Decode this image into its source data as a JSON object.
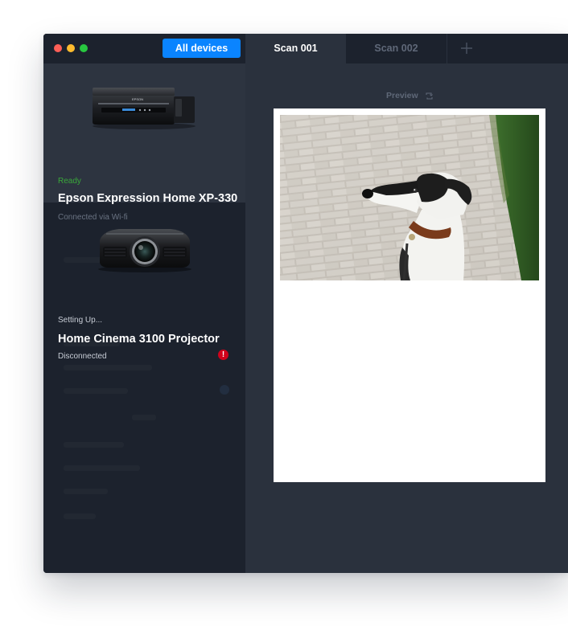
{
  "toolbar": {
    "all_devices_label": "All devices"
  },
  "devices": [
    {
      "status": "Ready",
      "status_color": "#3aa83a",
      "name": "Epson Expression Home XP-330",
      "connection": "Connected via Wi-fi",
      "icon": "printer-icon",
      "selected": true
    },
    {
      "status": "Setting Up...",
      "status_color": "#c8cdd6",
      "name": "Home Cinema 3100 Projector",
      "connection": "Disconnected",
      "icon": "projector-icon",
      "error_badge": "!",
      "error_color": "#d0021b",
      "selected": false
    }
  ],
  "tabs": [
    {
      "label": "Scan 001",
      "active": true
    },
    {
      "label": "Scan 002",
      "active": false
    }
  ],
  "preview": {
    "label": "Preview",
    "refresh_icon": "refresh-icon",
    "scan_image_icon": "dog-photo"
  },
  "colors": {
    "accent": "#0a84ff",
    "sidebar_bg": "#1c222d",
    "main_bg": "#2a313d",
    "ready": "#3aa83a",
    "error": "#d0021b"
  }
}
